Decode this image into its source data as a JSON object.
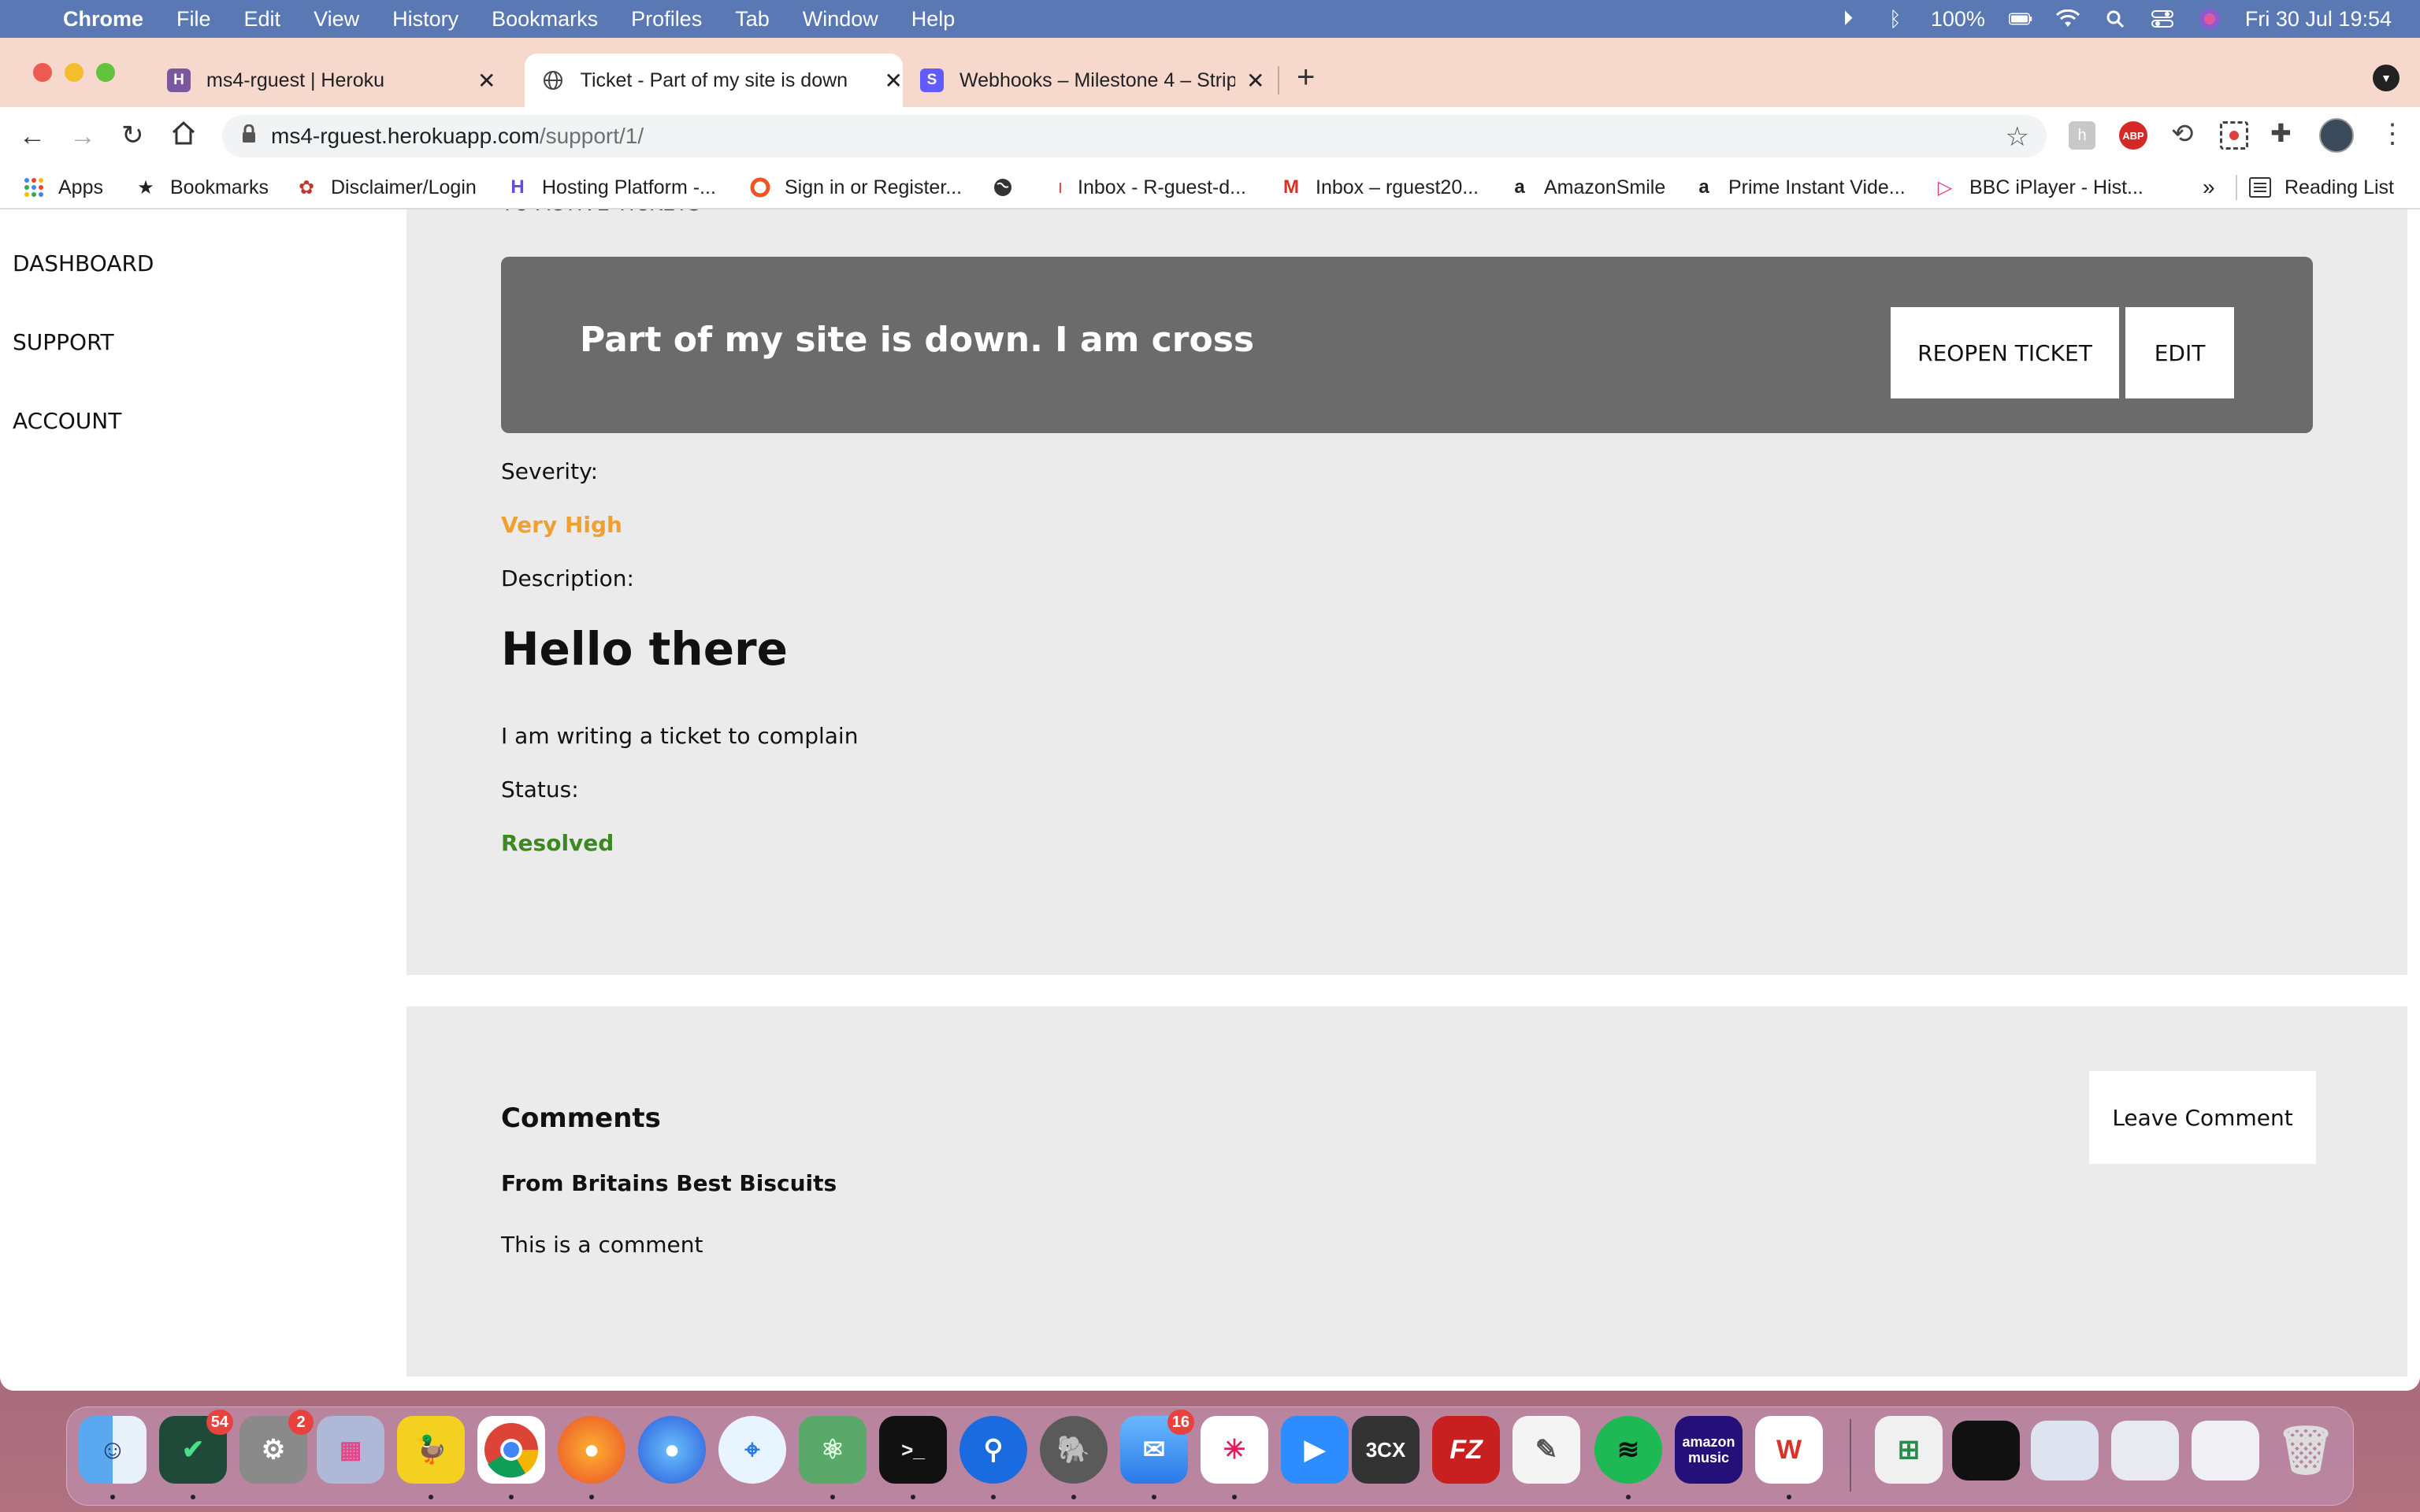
{
  "menubar": {
    "app": "Chrome",
    "items": [
      "File",
      "Edit",
      "View",
      "History",
      "Bookmarks",
      "Profiles",
      "Tab",
      "Window",
      "Help"
    ],
    "battery": "100%",
    "clock": "Fri 30 Jul  19:54"
  },
  "tabs": [
    {
      "title": "ms4-rguest | Heroku",
      "favicon": "H"
    },
    {
      "title": "Ticket - Part of my site is down",
      "favicon": "globe"
    },
    {
      "title": "Webhooks – Milestone 4 – Strip",
      "favicon": "S"
    }
  ],
  "omnibox": {
    "host": "ms4-rguest.herokuapp.com",
    "path": "/support/1/"
  },
  "bookmarks": {
    "items": [
      "Apps",
      "Bookmarks",
      "Disclaimer/Login",
      "Hosting Platform -...",
      "Sign in or Register...",
      "",
      "Inbox - R-guest-d...",
      "Inbox – rguest20...",
      "AmazonSmile",
      "Prime Instant Vide...",
      "BBC iPlayer - Hist..."
    ],
    "overflow": "»",
    "reading_list": "Reading List"
  },
  "sidebar": {
    "items": [
      "DASHBOARD",
      "SUPPORT",
      "ACCOUNT"
    ]
  },
  "ticket": {
    "back_link": "TO ACTIVE TICKETS",
    "title": "Part of my site is down. I am cross",
    "reopen_label": "REOPEN TICKET",
    "edit_label": "EDIT",
    "severity_label": "Severity:",
    "severity_value": "Very High",
    "severity_color": "#f0a030",
    "description_label": "Description:",
    "description_heading": "Hello there",
    "description_body": "I am writing a ticket to complain",
    "status_label": "Status:",
    "status_value": "Resolved",
    "status_color": "#3b8a1e"
  },
  "comments": {
    "heading": "Comments",
    "leave_label": "Leave Comment",
    "items": [
      {
        "author": "From Britains Best Biscuits",
        "body": "This is a comment"
      }
    ]
  },
  "dock": {
    "badges": {
      "tasks": "54",
      "settings": "2",
      "mail": "16"
    },
    "apps": [
      "finder",
      "tasks",
      "system-preferences",
      "launchpad",
      "cyberduck",
      "chrome",
      "firefox",
      "firefox-dev",
      "safari",
      "atom",
      "terminal",
      "1password",
      "tableplus",
      "mail",
      "slack",
      "zoom",
      "3cx",
      "filezilla",
      "textedit",
      "spotify",
      "amazon-music",
      "wps-office"
    ],
    "app_labels": {
      "3cx": "3CX",
      "amazon-music": "amazon music"
    }
  }
}
